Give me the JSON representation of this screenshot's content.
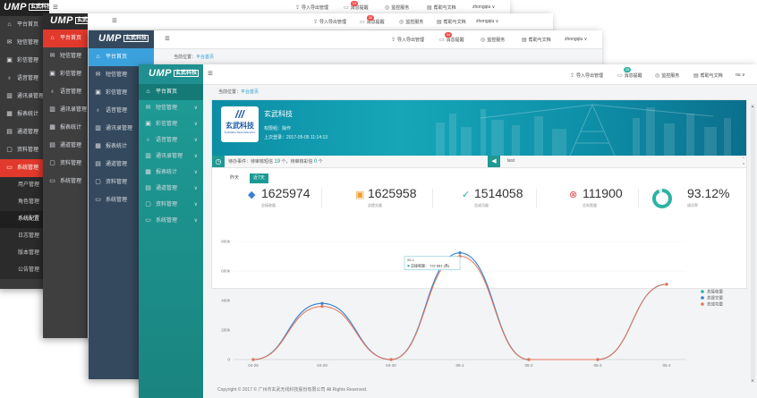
{
  "app": {
    "logo_ump": "UMP",
    "logo_cn": "玄武科技"
  },
  "toolbar": {
    "import_export": "导入导出管理",
    "messages": "消息提醒",
    "monitor": "监控服务",
    "help": "帮助与文档",
    "user": "zhongqiu",
    "user_short": "ou"
  },
  "badges": {
    "w1": "12",
    "w2": "32",
    "w3": "34",
    "w4": "26"
  },
  "sidebar": {
    "items": [
      {
        "label": "平台首页",
        "icon": "home-icon"
      },
      {
        "label": "短信管理",
        "icon": "mail-icon"
      },
      {
        "label": "彩信管理",
        "icon": "image-icon"
      },
      {
        "label": "语音管理",
        "icon": "mic-icon"
      },
      {
        "label": "通讯录管理",
        "icon": "contacts-icon"
      },
      {
        "label": "报表统计",
        "icon": "report-icon"
      },
      {
        "label": "通道管理",
        "icon": "channel-icon"
      },
      {
        "label": "资料管理",
        "icon": "folder-icon"
      },
      {
        "label": "系统管理",
        "icon": "monitor-icon"
      }
    ],
    "w1_subitems": [
      "用户管理",
      "角色管理",
      "系统配置",
      "日志管理",
      "版本管理",
      "公告管理"
    ]
  },
  "breadcrumb": {
    "prefix": "当前位置：",
    "current": "平台首页"
  },
  "company": {
    "name": "玄武科技",
    "logo_text": "玄武科技",
    "logo_sub": "XUANWU TECHNOLOGY",
    "role": "权限组：操作",
    "last_login": "上次登录：2017-05-05 11:14:13"
  },
  "notice": {
    "todo_prefix": "待办事件：",
    "todo_text1": "待审核短信",
    "todo_count1": "19",
    "todo_text2": "个，待审核彩信",
    "todo_count2": "0",
    "todo_suffix": "个",
    "test_label": "test"
  },
  "tabs": {
    "yesterday": "昨天",
    "recent7": "近7天"
  },
  "stats": [
    {
      "value": "1625974",
      "label": "总接收量",
      "icon": "tag-icon",
      "color": "#3a7fd5"
    },
    {
      "value": "1625958",
      "label": "总提交量",
      "icon": "inbox-icon",
      "color": "#f0a030"
    },
    {
      "value": "1514058",
      "label": "总成功量",
      "icon": "check-circle-icon",
      "color": "#2bb3a3"
    },
    {
      "value": "111900",
      "label": "总失败量",
      "icon": "x-circle-icon",
      "color": "#e05050"
    },
    {
      "value": "93.12%",
      "label": "成功率",
      "icon": "ring-icon",
      "color": "#2bb3a3"
    }
  ],
  "tooltip": {
    "date": "05-1",
    "label": "总接收量：",
    "value": "722 881 (条)"
  },
  "footer": {
    "text": "Copyright © 2017 © 广州市玄武无线科技股份有限公司 All Rights Reserved."
  },
  "chart_data": {
    "type": "line",
    "categories": [
      "04-28",
      "04-29",
      "04-30",
      "05-1",
      "05-2",
      "05-3",
      "05-4"
    ],
    "ylim": [
      0,
      800000
    ],
    "yticks": [
      "0",
      "200k",
      "400k",
      "600k",
      "800k"
    ],
    "legend_position": "right",
    "series": [
      {
        "name": "总接收量",
        "color": "#2bb3a3",
        "values": [
          0,
          380000,
          0,
          722881,
          0,
          0,
          510000
        ]
      },
      {
        "name": "总提交量",
        "color": "#3a7fd5",
        "values": [
          0,
          380000,
          0,
          722881,
          0,
          0,
          510000
        ]
      },
      {
        "name": "总成功量",
        "color": "#e8735a",
        "values": [
          0,
          360000,
          0,
          700000,
          0,
          0,
          510000
        ]
      }
    ]
  }
}
